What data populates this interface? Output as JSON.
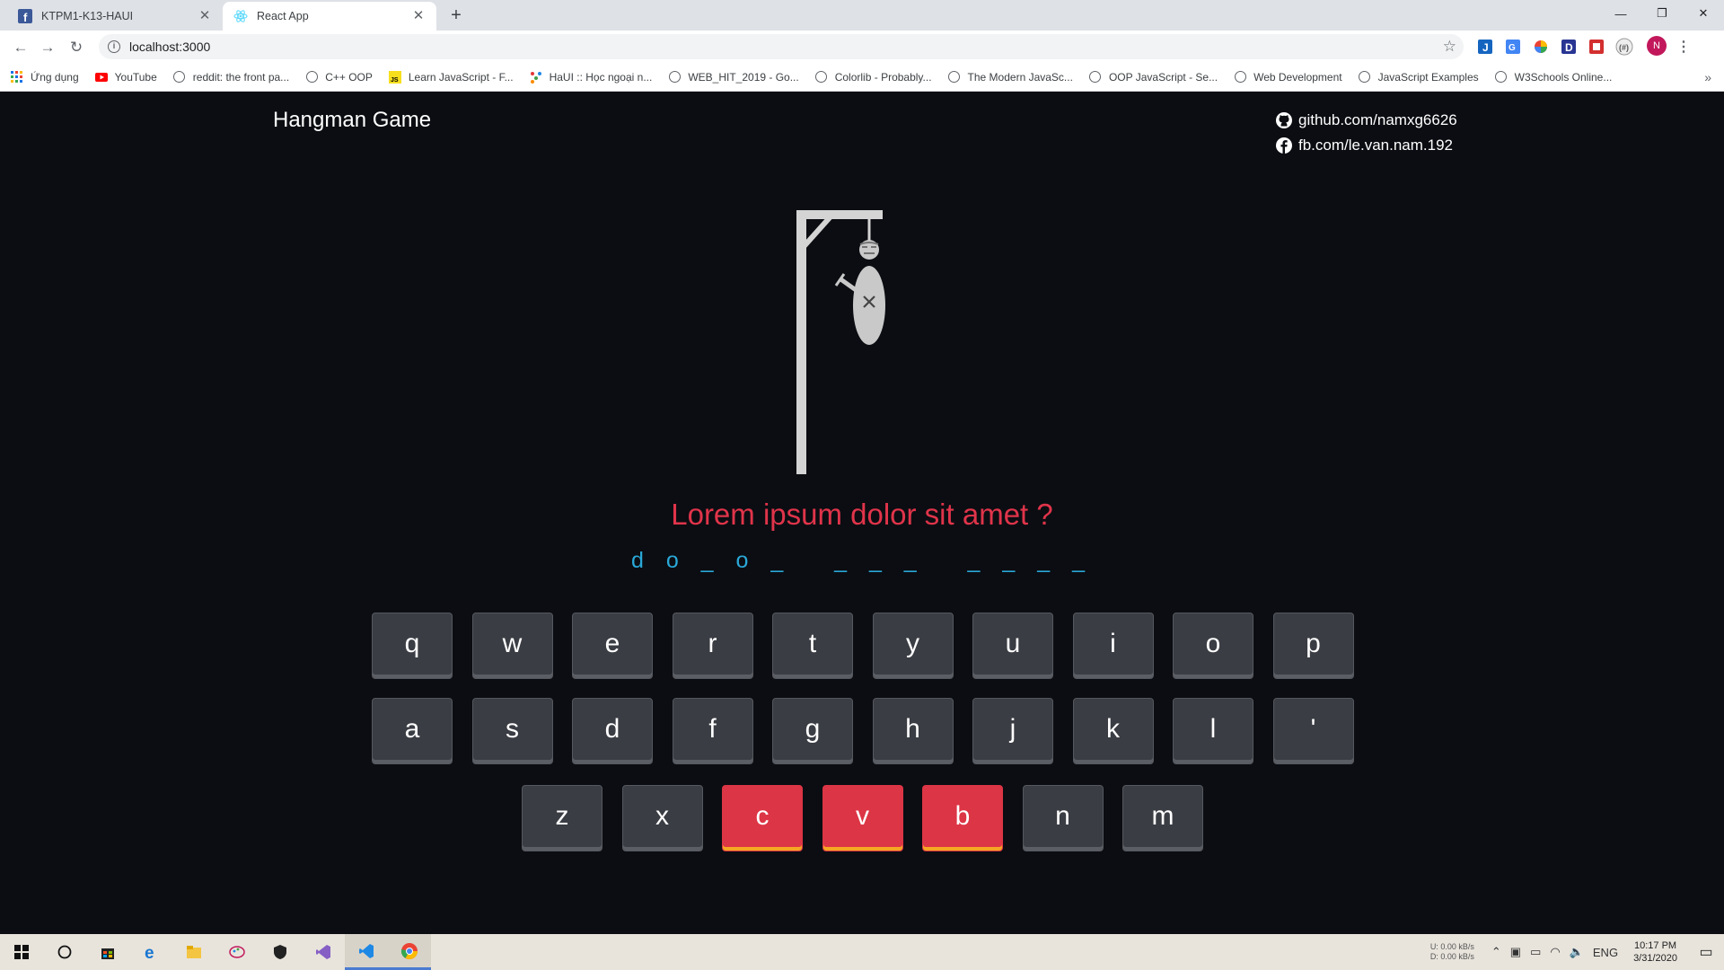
{
  "browser": {
    "tabs": [
      {
        "title": "KTPM1-K13-HAUI",
        "favicon": "facebook-icon",
        "active": false
      },
      {
        "title": "React App",
        "favicon": "react-icon",
        "active": true
      }
    ],
    "url": "localhost:3000",
    "bookmarks": [
      {
        "label": "Ứng dụng",
        "icon": "apps-grid-icon"
      },
      {
        "label": "YouTube",
        "icon": "youtube-icon"
      },
      {
        "label": "reddit: the front pa...",
        "icon": "globe-icon"
      },
      {
        "label": "C++ OOP",
        "icon": "globe-icon"
      },
      {
        "label": "Learn JavaScript - F...",
        "icon": "js-icon"
      },
      {
        "label": "HaUI :: Học ngoại n...",
        "icon": "haui-icon"
      },
      {
        "label": "WEB_HIT_2019 - Go...",
        "icon": "globe-icon"
      },
      {
        "label": "Colorlib - Probably...",
        "icon": "globe-icon"
      },
      {
        "label": "The Modern JavaSc...",
        "icon": "globe-icon"
      },
      {
        "label": "OOP JavaScript - Se...",
        "icon": "globe-icon"
      },
      {
        "label": "Web Development",
        "icon": "globe-icon"
      },
      {
        "label": "JavaScript Examples",
        "icon": "globe-icon"
      },
      {
        "label": "W3Schools Online...",
        "icon": "globe-icon"
      }
    ],
    "profile_initial": "N"
  },
  "app": {
    "title": "Hangman Game",
    "links": {
      "github": "github.com/namxg6626",
      "facebook": "fb.com/le.van.nam.192"
    },
    "question": "Lorem ipsum dolor sit amet ?",
    "masked_answer": "d o _ o _   _ _ _   _ _ _ _",
    "keyboard": {
      "row1": [
        "q",
        "w",
        "e",
        "r",
        "t",
        "y",
        "u",
        "i",
        "o",
        "p"
      ],
      "row2": [
        "a",
        "s",
        "d",
        "f",
        "g",
        "h",
        "j",
        "k",
        "l",
        "'"
      ],
      "row3": [
        "z",
        "x",
        "c",
        "v",
        "b",
        "n",
        "m"
      ]
    },
    "wrong_guesses": [
      "c",
      "v",
      "b"
    ],
    "colors": {
      "background": "#0b0d12",
      "question": "#e0344a",
      "answer": "#2aa8d8",
      "key": "#3a3d43",
      "wrong_key": "#dc3545",
      "wrong_key_underline": "#f5a623"
    }
  },
  "taskbar": {
    "net_up": "0.00 kB/s",
    "net_down": "0.00 kB/s",
    "net_up_label": "U:",
    "net_down_label": "D:",
    "language": "ENG",
    "time": "10:17 PM",
    "date": "3/31/2020"
  }
}
